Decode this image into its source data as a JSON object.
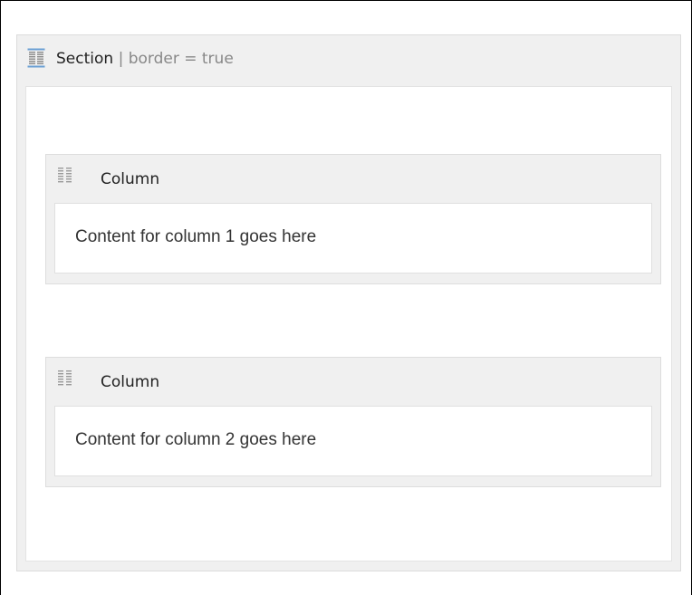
{
  "section": {
    "title": "Section",
    "separator": "|",
    "param": "border = true",
    "icon": "section-layout-icon"
  },
  "columns": [
    {
      "title": "Column",
      "icon": "column-layout-icon",
      "content": "Content for column 1 goes here"
    },
    {
      "title": "Column",
      "icon": "column-layout-icon",
      "content": "Content for column 2 goes here"
    }
  ],
  "colors": {
    "panel_bg": "#f0f0f0",
    "icon_blue": "#6a9fd4",
    "icon_gray": "#999999",
    "param_gray": "#888888"
  }
}
